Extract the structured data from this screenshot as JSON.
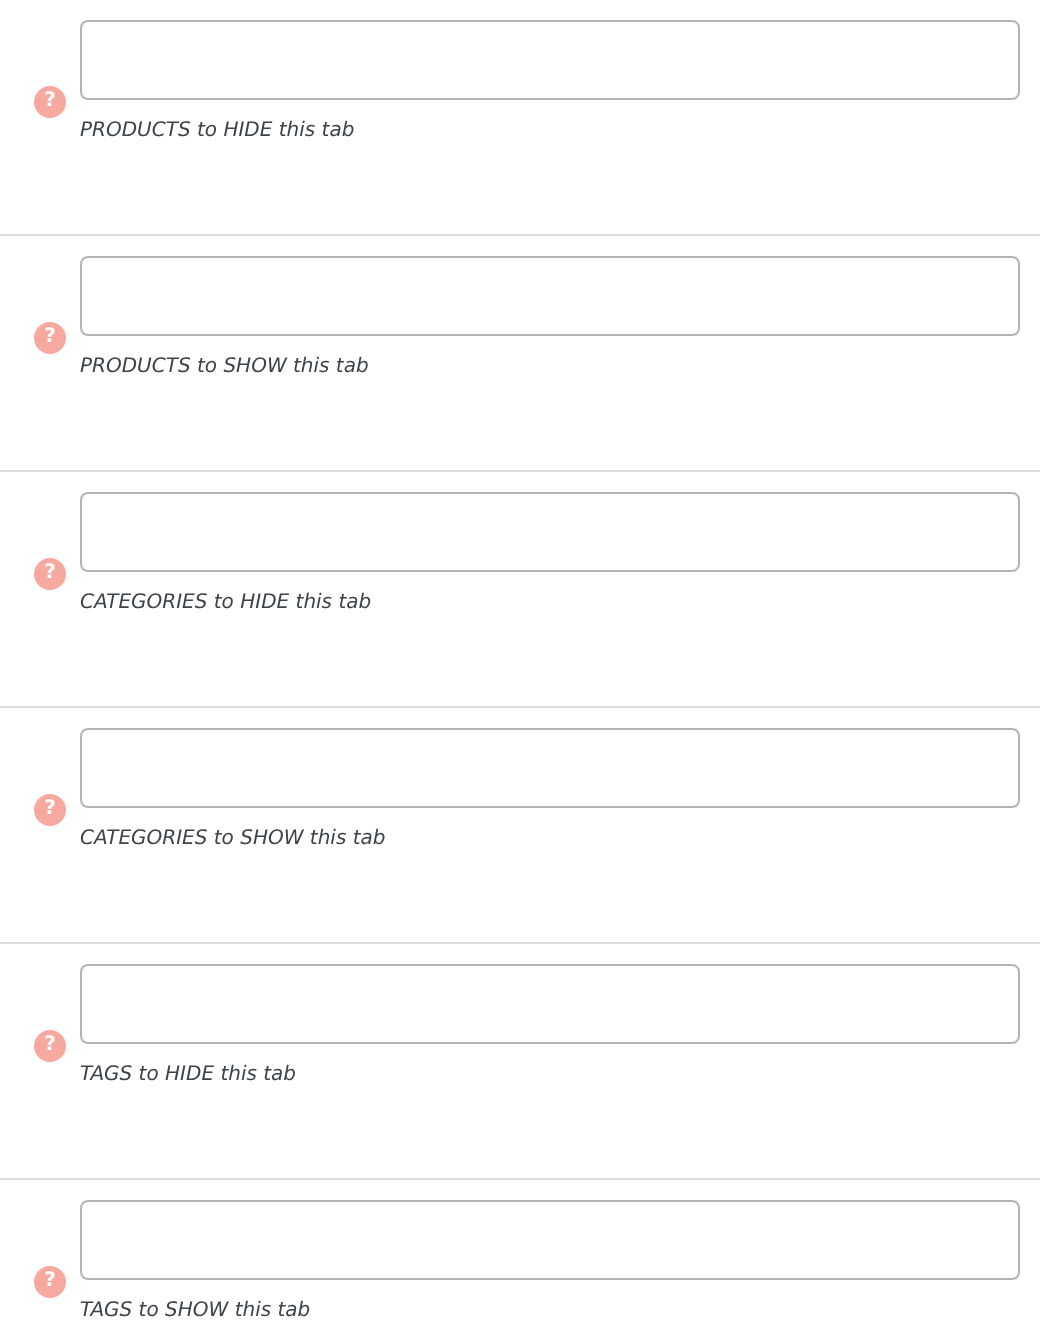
{
  "fields": [
    {
      "help": "?",
      "description": "PRODUCTS to HIDE this tab"
    },
    {
      "help": "?",
      "description": "PRODUCTS to SHOW this tab"
    },
    {
      "help": "?",
      "description": "CATEGORIES to HIDE this tab"
    },
    {
      "help": "?",
      "description": "CATEGORIES to SHOW this tab"
    },
    {
      "help": "?",
      "description": "TAGS to HIDE this tab"
    },
    {
      "help": "?",
      "description": "TAGS to SHOW this tab"
    }
  ]
}
